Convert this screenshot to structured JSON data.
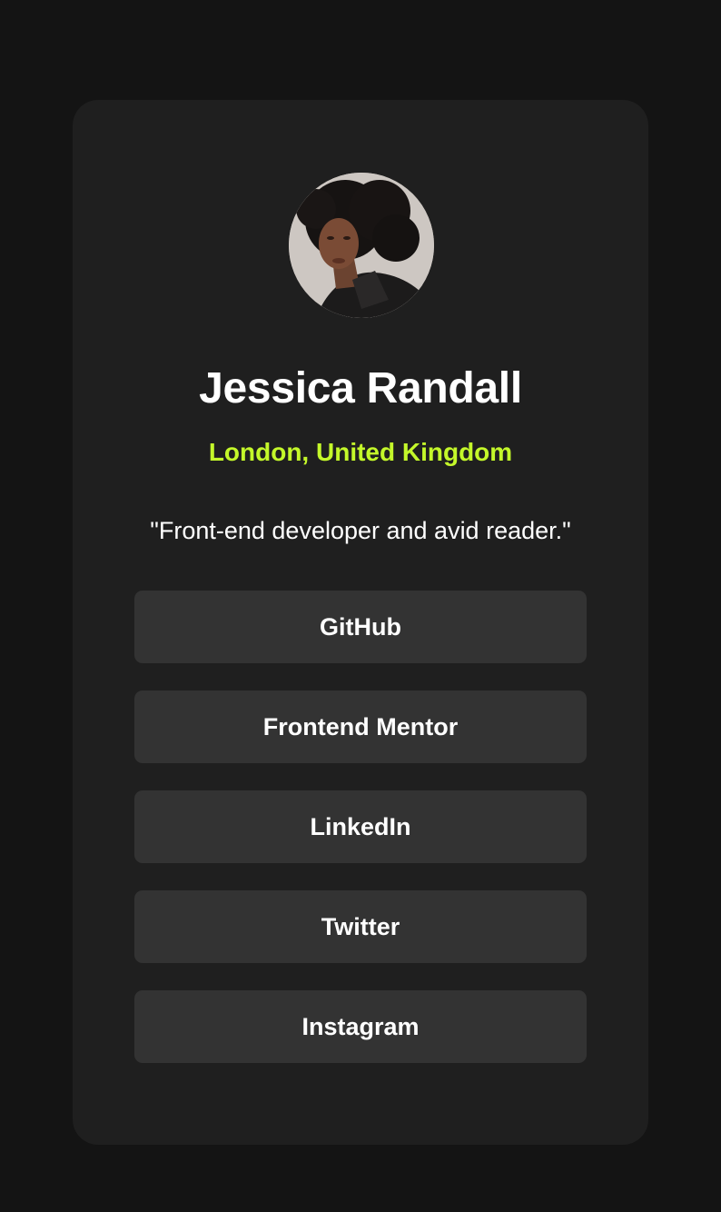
{
  "profile": {
    "name": "Jessica Randall",
    "location": "London, United Kingdom",
    "bio": "\"Front-end developer and avid reader.\"",
    "avatar_alt": "Jessica Randall"
  },
  "links": [
    {
      "label": "GitHub"
    },
    {
      "label": "Frontend Mentor"
    },
    {
      "label": "LinkedIn"
    },
    {
      "label": "Twitter"
    },
    {
      "label": "Instagram"
    }
  ],
  "colors": {
    "page_background": "#141414",
    "card_background": "#1f1f1f",
    "button_background": "#333333",
    "accent": "#c4f82a",
    "text": "#ffffff"
  }
}
